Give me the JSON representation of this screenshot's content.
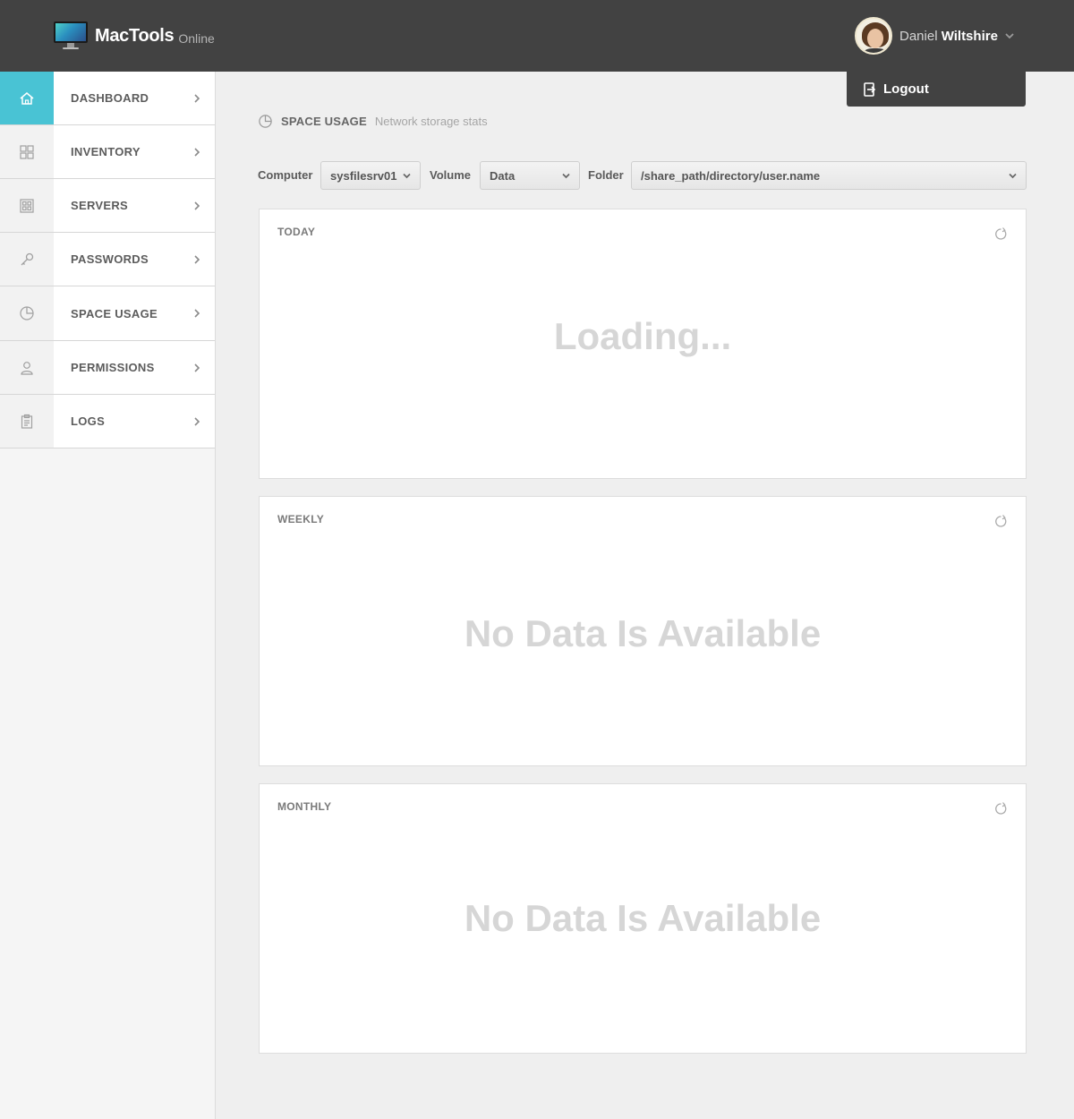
{
  "app": {
    "name": "MacTools",
    "subtitle": "Online"
  },
  "user": {
    "first_name": "Daniel",
    "last_name": "Wiltshire",
    "menu": {
      "logout_label": "Logout"
    }
  },
  "sidebar": {
    "items": [
      {
        "label": "DASHBOARD",
        "icon": "home-icon",
        "active": true
      },
      {
        "label": "INVENTORY",
        "icon": "grid-icon",
        "active": false
      },
      {
        "label": "SERVERS",
        "icon": "servers-icon",
        "active": false
      },
      {
        "label": "PASSWORDS",
        "icon": "key-icon",
        "active": false
      },
      {
        "label": "SPACE USAGE",
        "icon": "pie-chart-icon",
        "active": false
      },
      {
        "label": "PERMISSIONS",
        "icon": "user-icon",
        "active": false
      },
      {
        "label": "LOGS",
        "icon": "clipboard-icon",
        "active": false
      }
    ]
  },
  "page": {
    "title": "SPACE USAGE",
    "subtitle": "Network storage stats"
  },
  "filters": {
    "computer_label": "Computer",
    "computer_value": "sysfilesrv01",
    "volume_label": "Volume",
    "volume_value": "Data",
    "folder_label": "Folder",
    "folder_value": "/share_path/directory/user.name"
  },
  "panels": [
    {
      "title": "TODAY",
      "message": "Loading..."
    },
    {
      "title": "WEEKLY",
      "message": "No Data Is Available"
    },
    {
      "title": "MONTHLY",
      "message": "No Data Is Available"
    }
  ],
  "colors": {
    "header_bg": "#424242",
    "active_accent": "#49c3d4",
    "placeholder_text": "#d6d6d6"
  }
}
